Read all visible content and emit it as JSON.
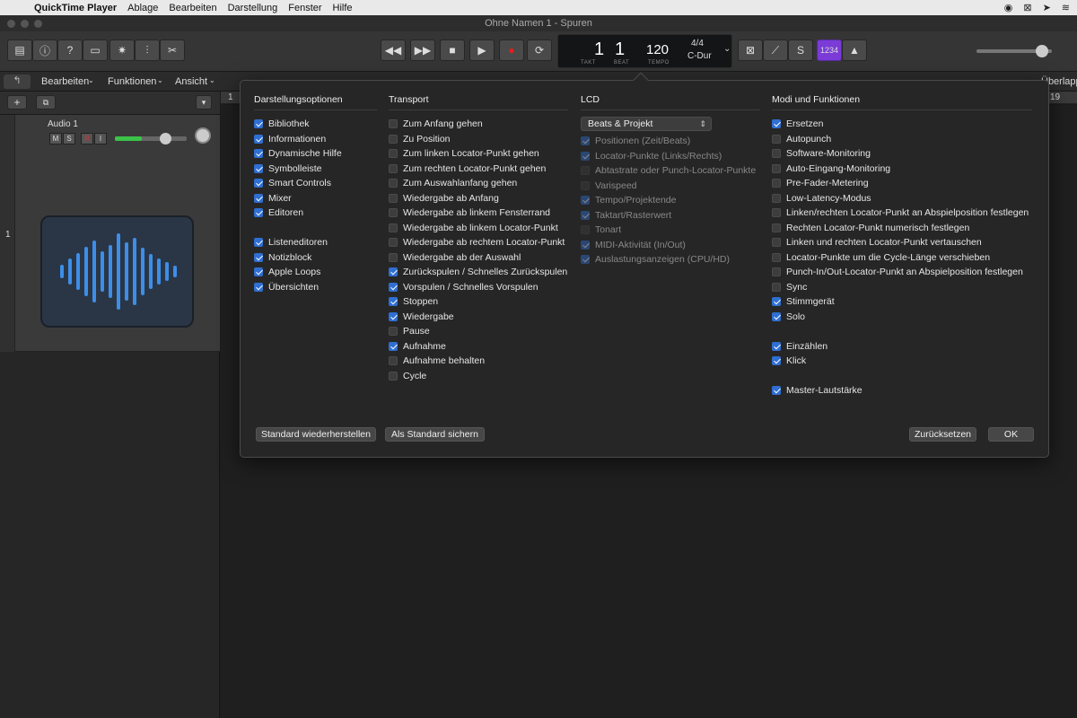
{
  "menubar": {
    "apple_icon": "apple-logo",
    "items": [
      "QuickTime Player",
      "Ablage",
      "Bearbeiten",
      "Darstellung",
      "Fenster",
      "Hilfe"
    ]
  },
  "window": {
    "title": "Ohne Namen 1 - Spuren"
  },
  "lcd": {
    "takt": "1",
    "beat": "1",
    "takt_label": "TAKT",
    "beat_label": "BEAT",
    "tempo": "120",
    "tempo_label": "TEMPO",
    "signature": "4/4",
    "key": "C-Dur"
  },
  "count_in_label": "1234",
  "subbar": {
    "edit": "Bearbeiten",
    "functions": "Funktionen",
    "view": "Ansicht"
  },
  "track": {
    "name": "Audio 1",
    "mute": "M",
    "solo": "S",
    "rec": "R",
    "input": "I",
    "number": "1"
  },
  "ruler": {
    "start": "1",
    "end": "19",
    "overlap": "Überlapp"
  },
  "dialog": {
    "display": {
      "title": "Darstellungsoptionen",
      "items": [
        {
          "label": "Bibliothek",
          "checked": true
        },
        {
          "label": "Informationen",
          "checked": true
        },
        {
          "label": "Dynamische Hilfe",
          "checked": true
        },
        {
          "label": "Symbolleiste",
          "checked": true
        },
        {
          "label": "Smart Controls",
          "checked": true
        },
        {
          "label": "Mixer",
          "checked": true
        },
        {
          "label": "Editoren",
          "checked": true
        },
        {
          "label": "Listeneditoren",
          "checked": true
        },
        {
          "label": "Notizblock",
          "checked": true
        },
        {
          "label": "Apple Loops",
          "checked": true
        },
        {
          "label": "Übersichten",
          "checked": true
        }
      ]
    },
    "transport": {
      "title": "Transport",
      "items": [
        {
          "label": "Zum Anfang gehen",
          "checked": false
        },
        {
          "label": "Zu Position",
          "checked": false
        },
        {
          "label": "Zum linken Locator-Punkt gehen",
          "checked": false
        },
        {
          "label": "Zum rechten Locator-Punkt gehen",
          "checked": false
        },
        {
          "label": "Zum Auswahlanfang gehen",
          "checked": false
        },
        {
          "label": "Wiedergabe ab Anfang",
          "checked": false
        },
        {
          "label": "Wiedergabe ab linkem Fensterrand",
          "checked": false
        },
        {
          "label": "Wiedergabe ab linkem Locator-Punkt",
          "checked": false
        },
        {
          "label": "Wiedergabe ab rechtem Locator-Punkt",
          "checked": false
        },
        {
          "label": "Wiedergabe ab der Auswahl",
          "checked": false
        },
        {
          "label": "Zurückspulen / Schnelles Zurückspulen",
          "checked": true
        },
        {
          "label": "Vorspulen / Schnelles Vorspulen",
          "checked": true
        },
        {
          "label": "Stoppen",
          "checked": true
        },
        {
          "label": "Wiedergabe",
          "checked": true
        },
        {
          "label": "Pause",
          "checked": false
        },
        {
          "label": "Aufnahme",
          "checked": true
        },
        {
          "label": "Aufnahme behalten",
          "checked": false
        },
        {
          "label": "Cycle",
          "checked": false
        }
      ]
    },
    "lcd": {
      "title": "LCD",
      "select_value": "Beats & Projekt",
      "items": [
        {
          "label": "Positionen (Zeit/Beats)",
          "checked": true
        },
        {
          "label": "Locator-Punkte (Links/Rechts)",
          "checked": true
        },
        {
          "label": "Abtastrate oder Punch-Locator-Punkte",
          "checked": false
        },
        {
          "label": "Varispeed",
          "checked": false
        },
        {
          "label": "Tempo/Projektende",
          "checked": true
        },
        {
          "label": "Taktart/Rasterwert",
          "checked": true
        },
        {
          "label": "Tonart",
          "checked": false
        },
        {
          "label": "MIDI-Aktivität (In/Out)",
          "checked": true
        },
        {
          "label": "Auslastungsanzeigen (CPU/HD)",
          "checked": true
        }
      ]
    },
    "modes": {
      "title": "Modi und Funktionen",
      "items": [
        {
          "label": "Ersetzen",
          "checked": true
        },
        {
          "label": "Autopunch",
          "checked": false
        },
        {
          "label": "Software-Monitoring",
          "checked": false
        },
        {
          "label": "Auto-Eingang-Monitoring",
          "checked": false
        },
        {
          "label": "Pre-Fader-Metering",
          "checked": false
        },
        {
          "label": "Low-Latency-Modus",
          "checked": false
        },
        {
          "label": "Linken/rechten Locator-Punkt an Abspielposition festlegen",
          "checked": false
        },
        {
          "label": "Rechten Locator-Punkt numerisch festlegen",
          "checked": false
        },
        {
          "label": "Linken und rechten Locator-Punkt vertauschen",
          "checked": false
        },
        {
          "label": "Locator-Punkte um die Cycle-Länge verschieben",
          "checked": false
        },
        {
          "label": "Punch-In/Out-Locator-Punkt an Abspielposition festlegen",
          "checked": false
        },
        {
          "label": "Sync",
          "checked": false
        },
        {
          "label": "Stimmgerät",
          "checked": true
        },
        {
          "label": "Solo",
          "checked": true
        },
        {
          "label": "Einzählen",
          "checked": true
        },
        {
          "label": "Klick",
          "checked": true
        },
        {
          "label": "Master-Lautstärke",
          "checked": true
        }
      ]
    },
    "buttons": {
      "restore": "Standard wiederherstellen",
      "save_default": "Als Standard sichern",
      "reset": "Zurücksetzen",
      "ok": "OK"
    }
  }
}
